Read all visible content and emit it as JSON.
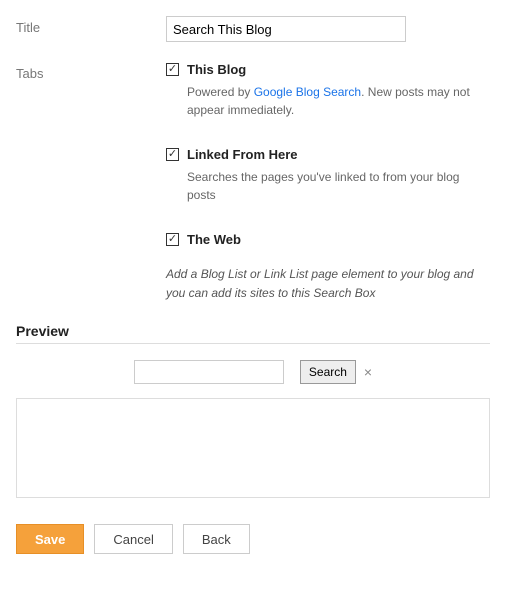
{
  "form": {
    "title_label": "Title",
    "title_value": "Search This Blog",
    "tabs_label": "Tabs",
    "tabs": [
      {
        "label": "This Blog",
        "desc_prefix": "Powered by ",
        "desc_link": "Google Blog Search",
        "desc_suffix": ". New posts may not appear immediately."
      },
      {
        "label": "Linked From Here",
        "desc": "Searches the pages you've linked to from your blog posts"
      },
      {
        "label": "The Web"
      }
    ],
    "hint": "Add a Blog List or Link List page element to your blog and you can add its sites to this Search Box"
  },
  "preview": {
    "title": "Preview",
    "search_button": "Search",
    "clear": "×"
  },
  "buttons": {
    "save": "Save",
    "cancel": "Cancel",
    "back": "Back"
  }
}
